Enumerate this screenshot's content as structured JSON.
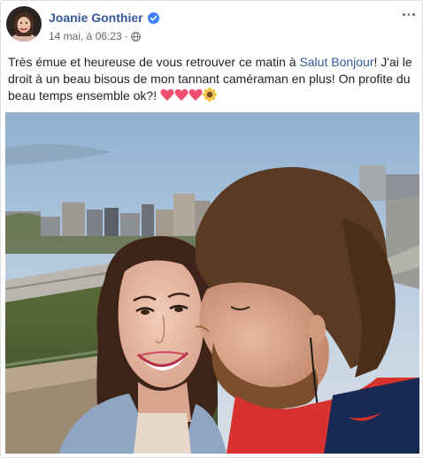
{
  "post": {
    "author": "Joanie Gonthier",
    "verified_icon": "verified-badge-icon",
    "date": "14 mai, à 06:23",
    "separator": "·",
    "audience_icon": "globe-icon",
    "more_icon": "more-options-icon",
    "text_before": "Très émue et heureuse de vous retrouver ce matin à ",
    "text_link": "Salut Bonjour",
    "text_after": "! J'ai le droit à un beau bisous de mon tannant caméraman en plus! On profite du beau temps ensemble ok?! ",
    "emojis": [
      "heart-emoji",
      "heart-emoji",
      "heart-emoji",
      "sunflower-emoji"
    ],
    "photo": "selfie-photo",
    "colors": {
      "link": "#365899",
      "heart": "#f0506e",
      "verified": "#4080ff"
    }
  }
}
